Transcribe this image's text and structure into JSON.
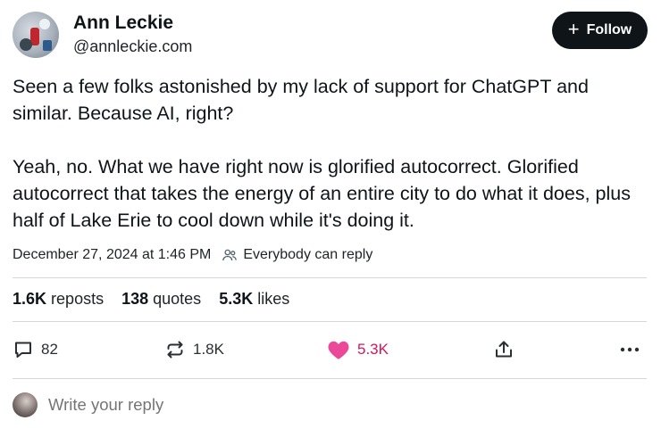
{
  "author": {
    "name": "Ann Leckie",
    "handle": "@annleckie.com"
  },
  "follow_button": {
    "label": "Follow"
  },
  "post": {
    "paragraphs": [
      "Seen a few folks astonished by my lack of support for ChatGPT and similar. Because AI, right?",
      "Yeah, no. What we have right now is glorified autocorrect. Glorified autocorrect that takes the energy of an entire city to do what it does, plus half of Lake Erie to cool down while it's doing it."
    ],
    "timestamp": "December 27, 2024 at 1:46 PM",
    "reply_setting": "Everybody can reply"
  },
  "stats": {
    "reposts_count": "1.6K",
    "reposts_label": "reposts",
    "quotes_count": "138",
    "quotes_label": "quotes",
    "likes_count": "5.3K",
    "likes_label": "likes"
  },
  "actions": {
    "replies": "82",
    "reposts": "1.8K",
    "likes": "5.3K",
    "like_color": "#d3165f"
  },
  "reply_box": {
    "placeholder": "Write your reply"
  },
  "icons": [
    "plus-icon",
    "people-icon",
    "reply-bubble-icon",
    "repost-arrows-icon",
    "heart-icon",
    "share-icon",
    "more-dots-icon"
  ]
}
